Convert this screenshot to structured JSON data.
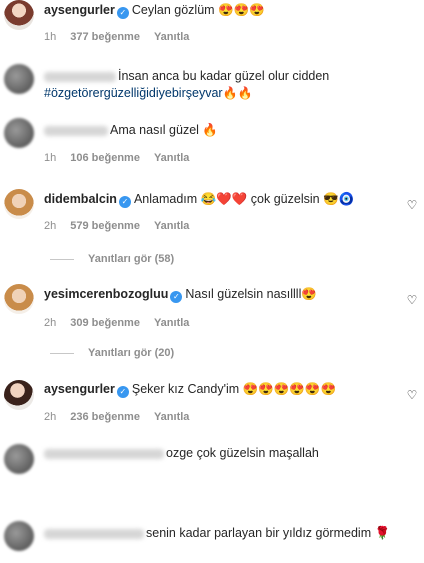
{
  "comments": [
    {
      "user": "aysengurler",
      "verified": true,
      "text": "Ceylan gözlüm 😍😍😍",
      "time": "1h",
      "likes": "377 beğenme",
      "reply": "Yanıtla"
    },
    {
      "user": "",
      "verified": false,
      "text": "İnsan anca bu kadar güzel olur cidden",
      "hashtag": "#özgetörergüzelliğidiyebirşeyvar",
      "emojis": "🔥🔥"
    },
    {
      "user": "",
      "verified": false,
      "text": "Ama nasıl güzel 🔥",
      "time": "1h",
      "likes": "106 beğenme",
      "reply": "Yanıtla"
    },
    {
      "user": "didembalcin",
      "verified": true,
      "text": "Anlamadım 😂❤️❤️ çok güzelsin 😎🧿",
      "time": "2h",
      "likes": "579 beğenme",
      "reply": "Yanıtla",
      "view_replies": "Yanıtları gör (58)"
    },
    {
      "user": "yesimcerenbozogluu",
      "verified": true,
      "text": "Nasıl güzelsin nasıllll😍",
      "time": "2h",
      "likes": "309 beğenme",
      "reply": "Yanıtla",
      "view_replies": "Yanıtları gör (20)"
    },
    {
      "user": "aysengurler",
      "verified": true,
      "text": "Şeker kız Candy'im 😍😍😍😍😍😍",
      "time": "2h",
      "likes": "236 beğenme",
      "reply": "Yanıtla"
    },
    {
      "user": "",
      "verified": false,
      "text": "ozge çok güzelsin maşallah"
    },
    {
      "user": "",
      "verified": false,
      "text": "senin kadar parlayan bir yıldız görmedim 🌹"
    }
  ],
  "icons": {
    "verified": "verified-badge-icon",
    "like": "heart-outline-icon"
  },
  "colors": {
    "verified": "#3897f0",
    "hashtag": "#00376b",
    "meta": "#8e8e8e"
  }
}
